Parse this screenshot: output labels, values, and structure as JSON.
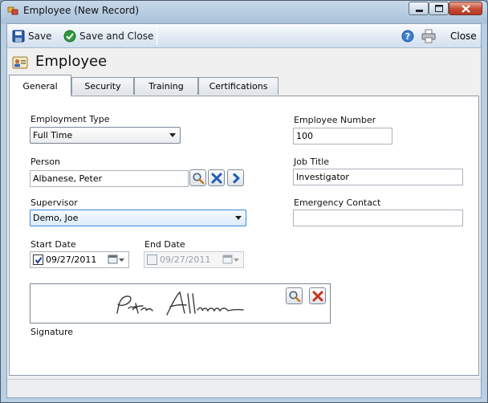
{
  "window": {
    "title": "Employee (New Record)"
  },
  "toolbar": {
    "save_label": "Save",
    "save_close_label": "Save and Close",
    "close_label": "Close"
  },
  "heading": "Employee",
  "tabs": [
    {
      "label": "General",
      "selected": true
    },
    {
      "label": "Security"
    },
    {
      "label": "Training"
    },
    {
      "label": "Certifications"
    }
  ],
  "form": {
    "employment_type": {
      "label": "Employment Type",
      "value": "Full Time"
    },
    "person": {
      "label": "Person",
      "value": "Albanese, Peter"
    },
    "supervisor": {
      "label": "Supervisor",
      "value": "Demo, Joe"
    },
    "start_date": {
      "label": "Start Date",
      "value": "09/27/2011",
      "checked": true
    },
    "end_date": {
      "label": "End Date",
      "value": "09/27/2011",
      "checked": false
    },
    "employee_number": {
      "label": "Employee Number",
      "value": "100"
    },
    "job_title": {
      "label": "Job Title",
      "value": "Investigator"
    },
    "emergency_contact": {
      "label": "Emergency Contact",
      "value": ""
    },
    "signature": {
      "label": "Signature"
    }
  },
  "colors": {
    "focus_border": "#3a8ad8",
    "focus_fill": "#e6f1fc",
    "accent_blue": "#1f5fb4",
    "delete_red": "#c8321e"
  }
}
